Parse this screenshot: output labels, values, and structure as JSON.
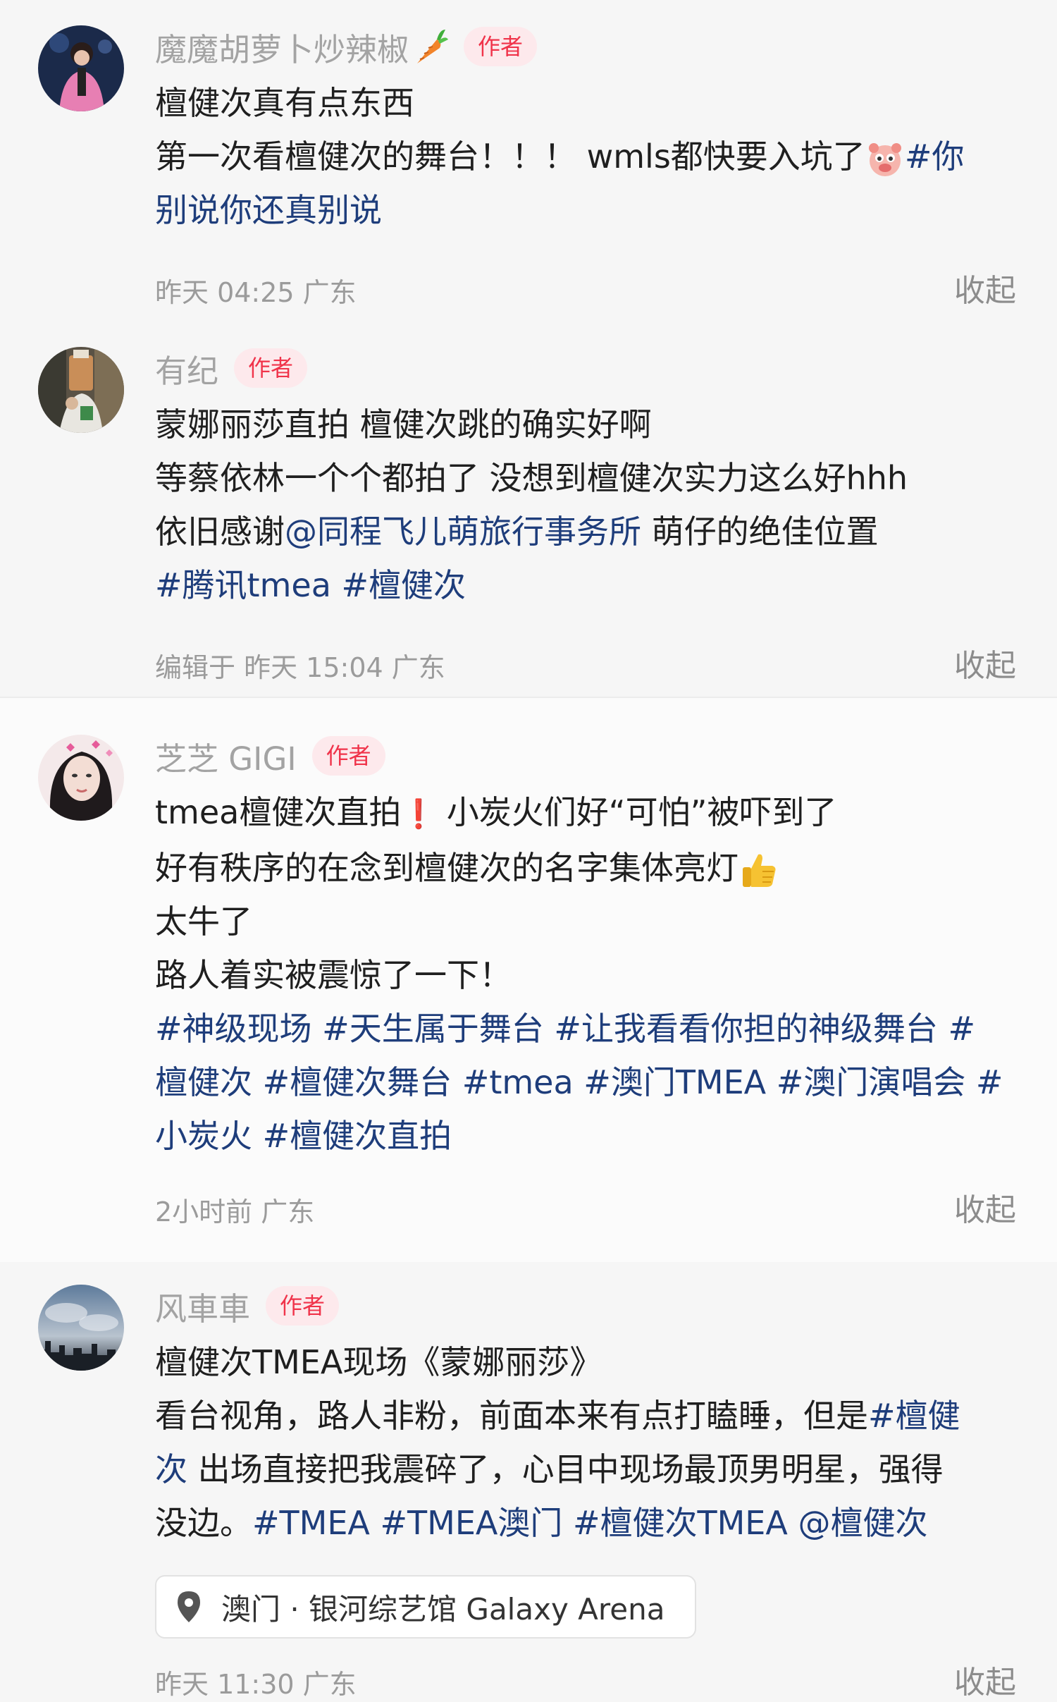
{
  "comments": [
    {
      "name": "魔魔胡萝卜炒辣椒",
      "badge": "作者",
      "lines": [
        {
          "text": "檀健次真有点东西"
        },
        {
          "text": "第一次看檀健次的舞台！！！ wmls都快要入坑了"
        },
        {
          "tag": "#你"
        },
        {
          "tag": "别说你还真别说"
        }
      ],
      "meta": "昨天 04:25 广东",
      "collapse": "收起"
    },
    {
      "name": "有纪",
      "badge": "作者",
      "lines": [
        {
          "text": "蒙娜丽莎直拍 檀健次跳的确实好啊"
        },
        {
          "text": "等蔡依林一个个都拍了 没想到檀健次实力这么好hhh"
        },
        {
          "text": "依旧感谢"
        },
        {
          "mention": "@同程飞儿萌旅行事务所"
        },
        {
          "text": " 萌仔的绝佳位置"
        },
        {
          "tag": "#腾讯tmea #檀健次"
        }
      ],
      "meta": "编辑于  昨天 15:04  广东",
      "collapse": "收起"
    },
    {
      "name": "芝芝 GIGI",
      "badge": "作者",
      "lines": [
        {
          "text": "tmea檀健次直拍"
        },
        {
          "text": "❗"
        },
        {
          "text": " 小炭火们好“可怕”被吓到了"
        },
        {
          "text": "好有秩序的在念到檀健次的名字集体亮灯"
        },
        {
          "text": "太牛了"
        },
        {
          "text": "路人着实被震惊了一下！"
        },
        {
          "tag": "#神级现场 #天生属于舞台 #让我看看你担的神级舞台 #"
        },
        {
          "tag": "檀健次 #檀健次舞台 #tmea #澳门TMEA #澳门演唱会 #"
        },
        {
          "tag": "小炭火 #檀健次直拍"
        }
      ],
      "meta": "2小时前  广东",
      "collapse": "收起"
    },
    {
      "name": "风車車",
      "badge": "作者",
      "lines": [
        {
          "text": "檀健次TMEA现场《蒙娜丽莎》"
        },
        {
          "text": "看台视角，路人非粉，前面本来有点打瞌睡，但是"
        },
        {
          "tag": "#檀健"
        },
        {
          "tag": "次"
        },
        {
          "text": " 出场直接把我震碎了，心目中现场最顶男明星，强得"
        },
        {
          "text": "没边。"
        },
        {
          "tag": "#TMEA #TMEA澳门 #檀健次TMEA @檀健次"
        }
      ],
      "location": "澳门 · 银河综艺馆 Galaxy Arena",
      "meta": "昨天 11:30 广东",
      "collapse": "收起"
    }
  ],
  "colors": {
    "tag": "#1e3d7b",
    "badge_text": "#f0334a",
    "badge_bg": "#fde9ec",
    "name": "#a3a3a3",
    "meta": "#9b9b9b"
  },
  "icons": [
    "carrot-emoji-icon",
    "pig-face-emoji-icon",
    "exclamation-emoji-icon",
    "thumbs-up-emoji-icon",
    "location-pin-icon"
  ]
}
